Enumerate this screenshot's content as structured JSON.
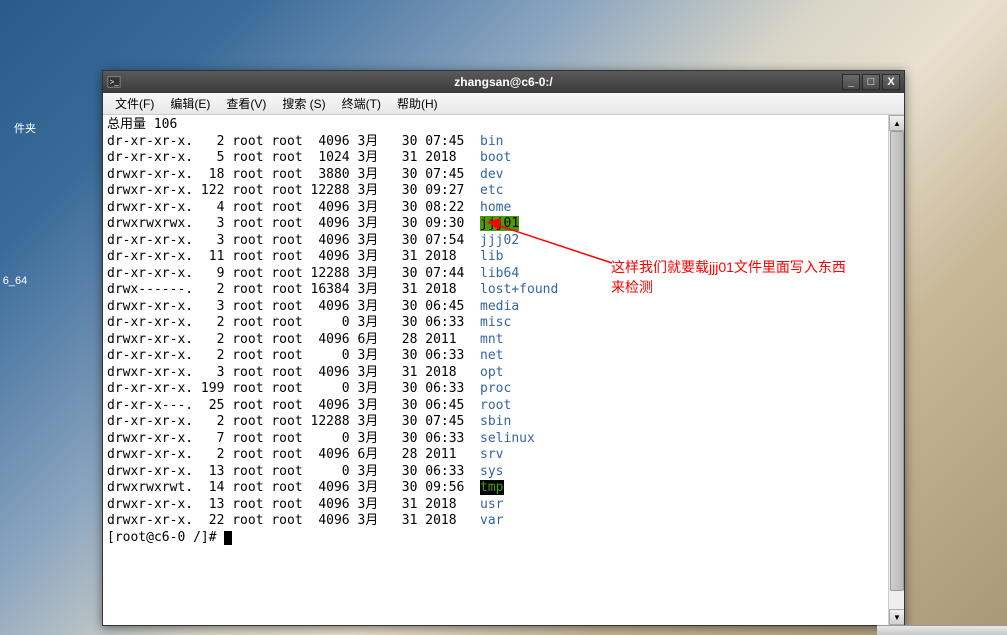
{
  "desktop": {
    "icon1_label": "件夹",
    "icon2_label": "6_64"
  },
  "window": {
    "title": "zhangsan@c6-0:/",
    "minimize": "_",
    "maximize": "□",
    "close": "X"
  },
  "menu": {
    "file": "文件(F)",
    "edit": "编辑(E)",
    "view": "查看(V)",
    "search": "搜索 (S)",
    "terminal": "终端(T)",
    "help": "帮助(H)"
  },
  "terminal": {
    "header": "总用量 106",
    "rows": [
      {
        "perms": "dr-xr-xr-x.",
        "links": "2",
        "owner": "root",
        "group": "root",
        "size": "4096",
        "month": "3月",
        "day": "30",
        "time": "07:45",
        "name": "bin",
        "cls": "file-dir"
      },
      {
        "perms": "dr-xr-xr-x.",
        "links": "5",
        "owner": "root",
        "group": "root",
        "size": "1024",
        "month": "3月",
        "day": "31",
        "time": "2018",
        "name": "boot",
        "cls": "file-dir"
      },
      {
        "perms": "drwxr-xr-x.",
        "links": "18",
        "owner": "root",
        "group": "root",
        "size": "3880",
        "month": "3月",
        "day": "30",
        "time": "07:45",
        "name": "dev",
        "cls": "file-dir"
      },
      {
        "perms": "drwxr-xr-x.",
        "links": "122",
        "owner": "root",
        "group": "root",
        "size": "12288",
        "month": "3月",
        "day": "30",
        "time": "09:27",
        "name": "etc",
        "cls": "file-dir"
      },
      {
        "perms": "drwxr-xr-x.",
        "links": "4",
        "owner": "root",
        "group": "root",
        "size": "4096",
        "month": "3月",
        "day": "30",
        "time": "08:22",
        "name": "home",
        "cls": "file-dir"
      },
      {
        "perms": "drwxrwxrwx.",
        "links": "3",
        "owner": "root",
        "group": "root",
        "size": "4096",
        "month": "3月",
        "day": "30",
        "time": "09:30",
        "name": "jjj01",
        "cls": "file-dir-hl1"
      },
      {
        "perms": "dr-xr-xr-x.",
        "links": "3",
        "owner": "root",
        "group": "root",
        "size": "4096",
        "month": "3月",
        "day": "30",
        "time": "07:54",
        "name": "jjj02",
        "cls": "file-dir"
      },
      {
        "perms": "dr-xr-xr-x.",
        "links": "11",
        "owner": "root",
        "group": "root",
        "size": "4096",
        "month": "3月",
        "day": "31",
        "time": "2018",
        "name": "lib",
        "cls": "file-dir"
      },
      {
        "perms": "dr-xr-xr-x.",
        "links": "9",
        "owner": "root",
        "group": "root",
        "size": "12288",
        "month": "3月",
        "day": "30",
        "time": "07:44",
        "name": "lib64",
        "cls": "file-dir"
      },
      {
        "perms": "drwx------.",
        "links": "2",
        "owner": "root",
        "group": "root",
        "size": "16384",
        "month": "3月",
        "day": "31",
        "time": "2018",
        "name": "lost+found",
        "cls": "file-dir"
      },
      {
        "perms": "drwxr-xr-x.",
        "links": "3",
        "owner": "root",
        "group": "root",
        "size": "4096",
        "month": "3月",
        "day": "30",
        "time": "06:45",
        "name": "media",
        "cls": "file-dir"
      },
      {
        "perms": "dr-xr-xr-x.",
        "links": "2",
        "owner": "root",
        "group": "root",
        "size": "0",
        "month": "3月",
        "day": "30",
        "time": "06:33",
        "name": "misc",
        "cls": "file-dir"
      },
      {
        "perms": "drwxr-xr-x.",
        "links": "2",
        "owner": "root",
        "group": "root",
        "size": "4096",
        "month": "6月",
        "day": "28",
        "time": "2011",
        "name": "mnt",
        "cls": "file-dir"
      },
      {
        "perms": "dr-xr-xr-x.",
        "links": "2",
        "owner": "root",
        "group": "root",
        "size": "0",
        "month": "3月",
        "day": "30",
        "time": "06:33",
        "name": "net",
        "cls": "file-dir"
      },
      {
        "perms": "drwxr-xr-x.",
        "links": "3",
        "owner": "root",
        "group": "root",
        "size": "4096",
        "month": "3月",
        "day": "31",
        "time": "2018",
        "name": "opt",
        "cls": "file-dir"
      },
      {
        "perms": "dr-xr-xr-x.",
        "links": "199",
        "owner": "root",
        "group": "root",
        "size": "0",
        "month": "3月",
        "day": "30",
        "time": "06:33",
        "name": "proc",
        "cls": "file-dir"
      },
      {
        "perms": "dr-xr-x---.",
        "links": "25",
        "owner": "root",
        "group": "root",
        "size": "4096",
        "month": "3月",
        "day": "30",
        "time": "06:45",
        "name": "root",
        "cls": "file-dir"
      },
      {
        "perms": "dr-xr-xr-x.",
        "links": "2",
        "owner": "root",
        "group": "root",
        "size": "12288",
        "month": "3月",
        "day": "30",
        "time": "07:45",
        "name": "sbin",
        "cls": "file-dir"
      },
      {
        "perms": "drwxr-xr-x.",
        "links": "7",
        "owner": "root",
        "group": "root",
        "size": "0",
        "month": "3月",
        "day": "30",
        "time": "06:33",
        "name": "selinux",
        "cls": "file-dir"
      },
      {
        "perms": "drwxr-xr-x.",
        "links": "2",
        "owner": "root",
        "group": "root",
        "size": "4096",
        "month": "6月",
        "day": "28",
        "time": "2011",
        "name": "srv",
        "cls": "file-dir"
      },
      {
        "perms": "drwxr-xr-x.",
        "links": "13",
        "owner": "root",
        "group": "root",
        "size": "0",
        "month": "3月",
        "day": "30",
        "time": "06:33",
        "name": "sys",
        "cls": "file-dir"
      },
      {
        "perms": "drwxrwxrwt.",
        "links": "14",
        "owner": "root",
        "group": "root",
        "size": "4096",
        "month": "3月",
        "day": "30",
        "time": "09:56",
        "name": "tmp",
        "cls": "file-dir-hl2"
      },
      {
        "perms": "drwxr-xr-x.",
        "links": "13",
        "owner": "root",
        "group": "root",
        "size": "4096",
        "month": "3月",
        "day": "31",
        "time": "2018",
        "name": "usr",
        "cls": "file-dir"
      },
      {
        "perms": "drwxr-xr-x.",
        "links": "22",
        "owner": "root",
        "group": "root",
        "size": "4096",
        "month": "3月",
        "day": "31",
        "time": "2018",
        "name": "var",
        "cls": "file-dir"
      }
    ],
    "prompt": "[root@c6-0 /]# "
  },
  "annotation": {
    "line1": "这样我们就要载jjj01文件里面写入东西",
    "line2": "来检测"
  }
}
